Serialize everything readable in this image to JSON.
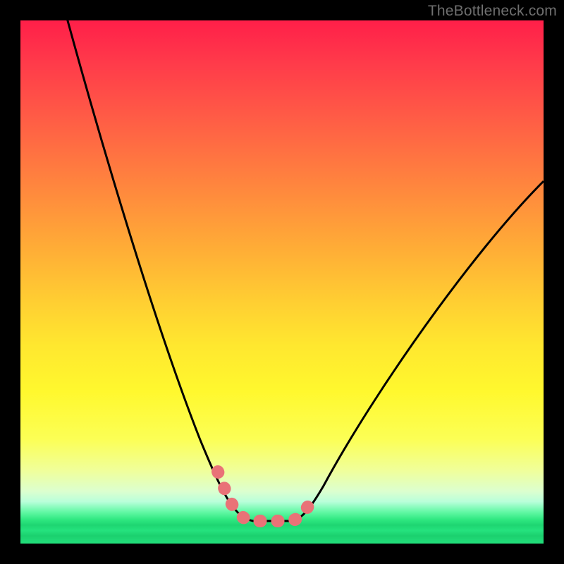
{
  "watermark": "TheBottleneck.com",
  "chart_data": {
    "type": "line",
    "title": "",
    "xlabel": "",
    "ylabel": "",
    "xlim": [
      0,
      100
    ],
    "ylim": [
      0,
      100
    ],
    "series": [
      {
        "name": "bottleneck-curve",
        "x": [
          0,
          5,
          10,
          15,
          20,
          25,
          30,
          35,
          38,
          40,
          42,
          44,
          46,
          50,
          55,
          60,
          65,
          70,
          75,
          80,
          85,
          90,
          95,
          100
        ],
        "values": [
          106,
          95,
          84,
          72,
          61,
          50,
          38,
          24,
          14,
          7,
          3,
          1,
          1,
          1,
          3,
          9,
          17,
          27,
          37,
          47,
          56,
          64,
          71,
          77
        ]
      }
    ],
    "highlight": {
      "name": "optimal-region",
      "x": [
        38,
        40,
        42,
        44,
        46,
        50,
        52,
        55
      ],
      "values": [
        14,
        7,
        3,
        1,
        1,
        1,
        2,
        3
      ]
    }
  }
}
